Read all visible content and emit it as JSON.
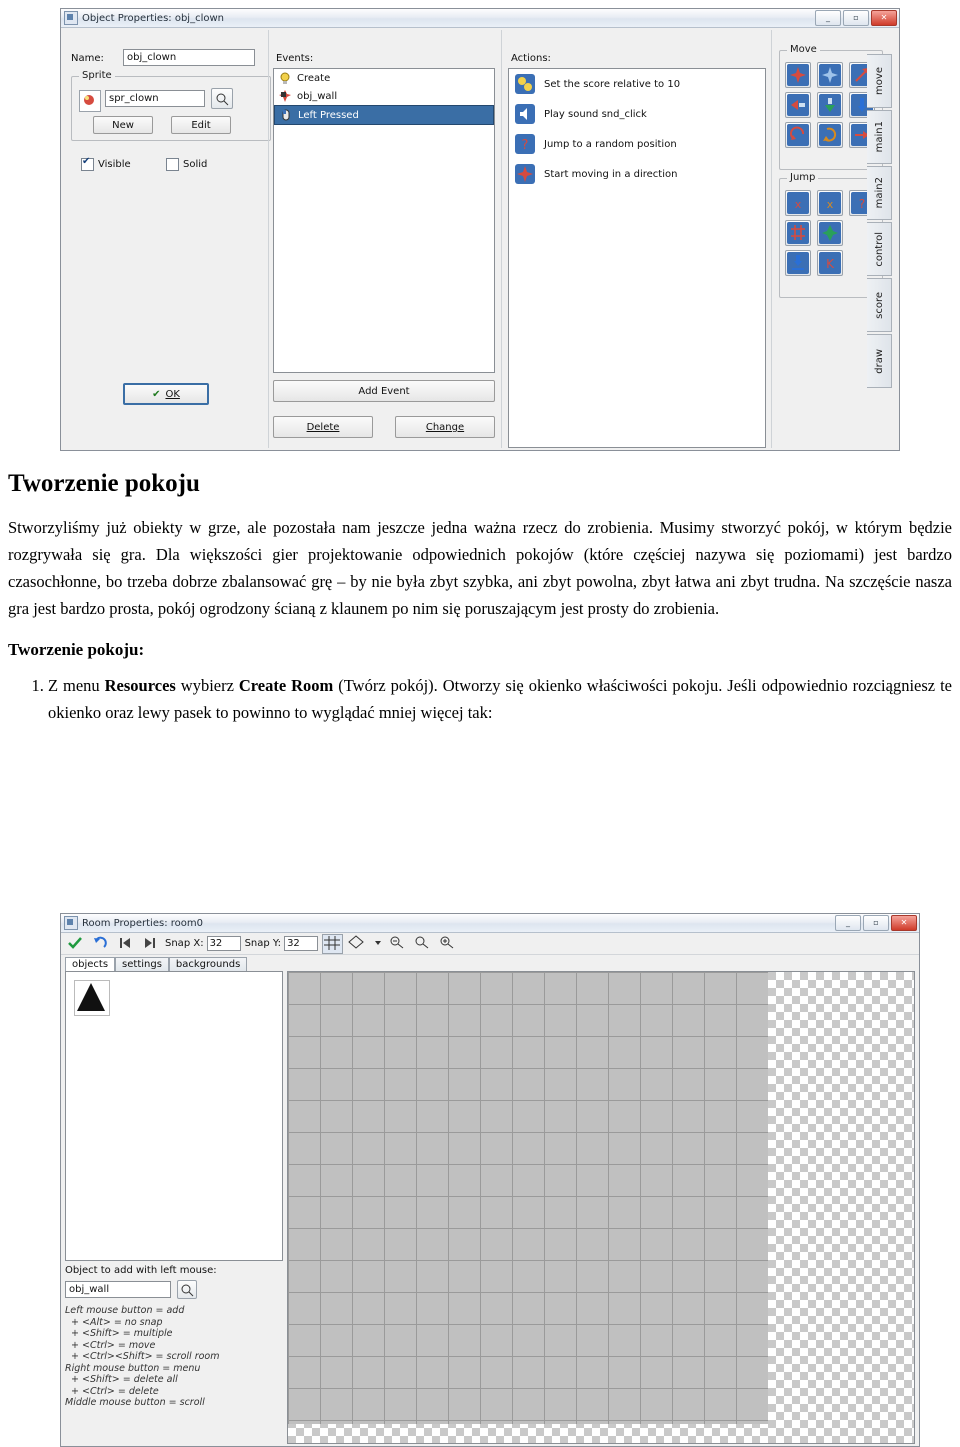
{
  "object_window": {
    "title": "Object Properties: obj_clown",
    "icon": "object-icon",
    "window_buttons": {
      "minimize": "_",
      "maximize": "▫",
      "close": "✕"
    },
    "name_label": "Name:",
    "name_value": "obj_clown",
    "sprite_group": "Sprite",
    "sprite_value": "spr_clown",
    "sprite_new_button": "New",
    "sprite_edit_button": "Edit",
    "visible_checkbox": "Visible",
    "visible_checked": true,
    "solid_checkbox": "Solid",
    "solid_checked": false,
    "ok_button": "OK",
    "events_label": "Events:",
    "events": [
      {
        "label": "Create",
        "icon": "create-event-icon",
        "selected": false
      },
      {
        "label": "obj_wall",
        "icon": "collision-event-icon",
        "selected": false
      },
      {
        "label": "Left Pressed",
        "icon": "mouse-event-icon",
        "selected": true
      }
    ],
    "add_event_button": "Add Event",
    "delete_button": "Delete",
    "change_button": "Change",
    "actions_label": "Actions:",
    "actions": [
      {
        "label": "Set the score relative to 10",
        "icon": "score-action-icon"
      },
      {
        "label": "Play sound snd_click",
        "icon": "sound-action-icon"
      },
      {
        "label": "Jump to a random position",
        "icon": "jump-action-icon"
      },
      {
        "label": "Start moving in a direction",
        "icon": "move-action-icon"
      }
    ],
    "action_groups": [
      {
        "legend": "Move"
      },
      {
        "legend": "Jump"
      }
    ],
    "tabs": [
      "move",
      "main1",
      "main2",
      "control",
      "score",
      "draw"
    ]
  },
  "document": {
    "heading": "Tworzenie pokoju",
    "paragraph_1": "Stworzyliśmy już obiekty w grze, ale pozostała nam jeszcze jedna ważna rzecz do zrobienia. Musimy stworzyć pokój, w którym będzie rozgrywała się gra. Dla większości gier projektowanie odpowiednich pokojów (które częściej nazywa się poziomami) jest bardzo czasochłonne, bo trzeba dobrze zbalansować grę – by nie była zbyt szybka, ani zbyt powolna, zbyt łatwa ani zbyt trudna. Na szczęście nasza gra jest bardzo prosta, pokój ogrodzony ścianą z klaunem po nim się poruszającym jest prosty do zrobienia.",
    "subheading": "Tworzenie pokoju:",
    "step_1_pre": "Z menu ",
    "step_1_bold_1": "Resources",
    "step_1_mid": " wybierz ",
    "step_1_bold_2": "Create Room",
    "step_1_post": " (Twórz pokój). Otworzy się okienko właściwości pokoju.  Jeśli odpowiednio rozciągniesz te okienko oraz lewy pasek to powinno to wyglądać mniej więcej tak:"
  },
  "room_window": {
    "title": "Room Properties: room0",
    "icon": "room-icon",
    "window_buttons": {
      "minimize": "_",
      "maximize": "▫",
      "close": "✕"
    },
    "toolbar": {
      "ok_icon": "check-icon",
      "undo_icon": "undo-icon",
      "first_icon": "first-icon",
      "next_icon": "next-icon",
      "snap_x_label": "Snap X:",
      "snap_x_value": "32",
      "snap_y_label": "Snap Y:",
      "snap_y_value": "32",
      "grid_icon": "grid-icon",
      "isometric_icon": "isometric-icon",
      "dropdown_icon": "chevron-down-icon",
      "zoom_out_icon": "zoom-out-icon",
      "zoom_reset_icon": "zoom-reset-icon",
      "zoom_in_icon": "zoom-in-icon"
    },
    "tabs": [
      {
        "label": "objects",
        "active": true
      },
      {
        "label": "settings",
        "active": false
      },
      {
        "label": "backgrounds",
        "active": false
      }
    ],
    "object_hint_label": "Object to add with left mouse:",
    "object_value": "obj_wall",
    "help_text": "Left mouse button = add\n  + <Alt> = no snap\n  + <Shift> = multiple\n  + <Ctrl> = move\n  + <Ctrl><Shift> = scroll room\nRight mouse button = menu\n  + <Shift> = delete all\n  + <Ctrl> = delete\nMiddle mouse button = scroll"
  }
}
